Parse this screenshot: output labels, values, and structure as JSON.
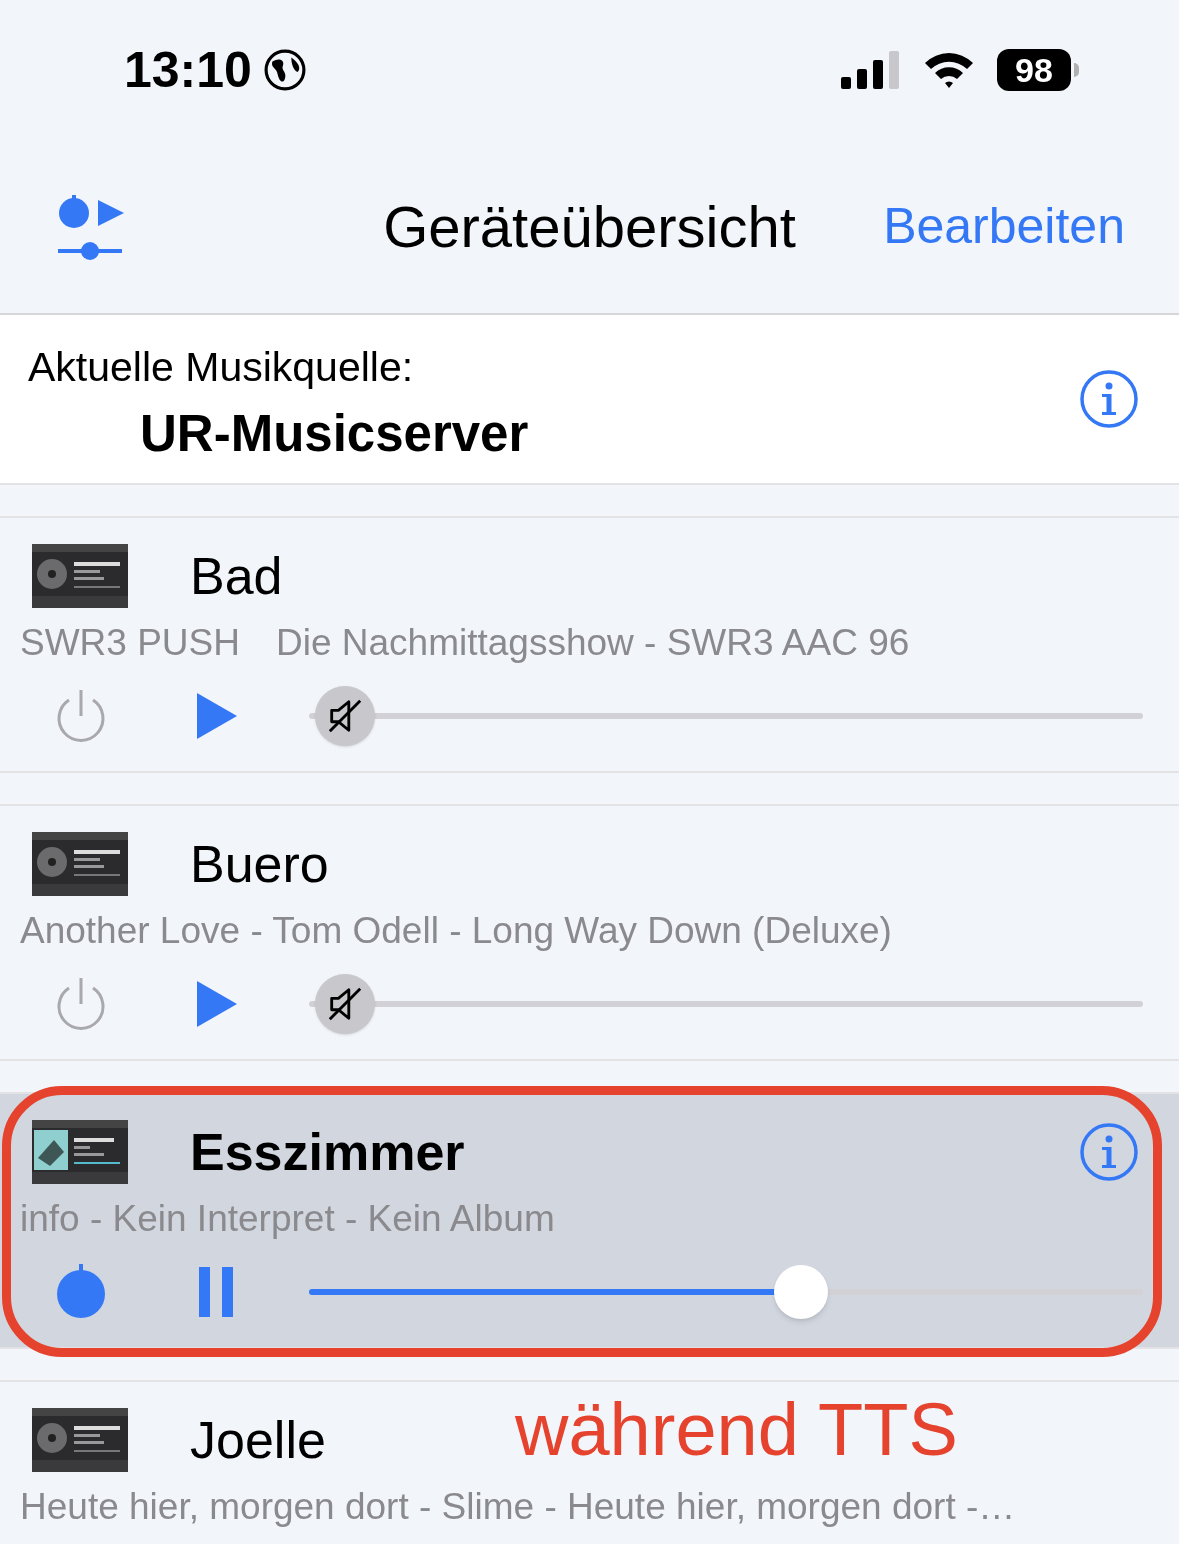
{
  "status_bar": {
    "time": "13:10",
    "battery": "98"
  },
  "nav_bar": {
    "title": "Geräteübersicht",
    "edit_button": "Bearbeiten"
  },
  "music_source": {
    "label": "Aktuelle Musikquelle:",
    "name": "UR-Musicserver"
  },
  "devices": [
    {
      "name": "Bad",
      "selected": false,
      "thumbnail": {
        "kind": "disc"
      },
      "info_button": false,
      "subtitle": [
        "SWR3 PUSH",
        "Die Nachmittagsshow - SWR3 AAC 96"
      ],
      "controls": {
        "power_on": false,
        "playing": false,
        "muted": true,
        "level": 0
      }
    },
    {
      "name": "Buero",
      "selected": false,
      "thumbnail": {
        "kind": "disc"
      },
      "info_button": false,
      "subtitle": [
        "Another Love - Tom Odell - Long Way Down (Deluxe)"
      ],
      "controls": {
        "power_on": false,
        "playing": false,
        "muted": true,
        "level": 0
      }
    },
    {
      "name": "Esszimmer",
      "selected": true,
      "thumbnail": {
        "kind": "cover"
      },
      "info_button": true,
      "subtitle": [
        "info - Kein Interpret - Kein Album"
      ],
      "controls": {
        "power_on": true,
        "playing": true,
        "muted": false,
        "level": 0.59
      },
      "annotation": {
        "text": "während TTS"
      }
    },
    {
      "name": "Joelle",
      "selected": false,
      "thumbnail": {
        "kind": "disc"
      },
      "info_button": false,
      "subtitle": [
        "Heute hier, morgen dort - Slime - Heute hier, morgen dort -…"
      ]
    }
  ]
}
